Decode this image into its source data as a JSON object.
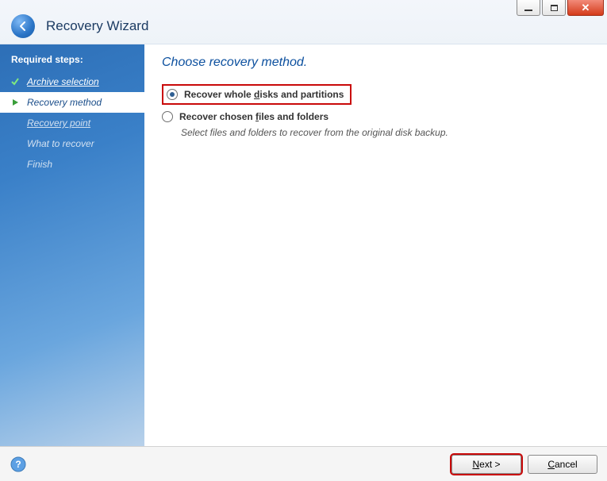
{
  "header": {
    "title": "Recovery Wizard"
  },
  "sidebar": {
    "heading": "Required steps:",
    "steps": [
      {
        "label": "Archive selection"
      },
      {
        "label": "Recovery method"
      },
      {
        "label": "Recovery point"
      },
      {
        "label": "What to recover"
      },
      {
        "label": "Finish"
      }
    ]
  },
  "content": {
    "heading": "Choose recovery method.",
    "option1_prefix": "Recover whole ",
    "option1_ul": "d",
    "option1_suffix": "isks and partitions",
    "option2_prefix": "Recover chosen ",
    "option2_ul": "f",
    "option2_suffix": "iles and folders",
    "option2_desc": "Select files and folders to recover from the original disk backup."
  },
  "footer": {
    "next_ul": "N",
    "next_rest": "ext >",
    "cancel_ul": "C",
    "cancel_rest": "ancel"
  }
}
